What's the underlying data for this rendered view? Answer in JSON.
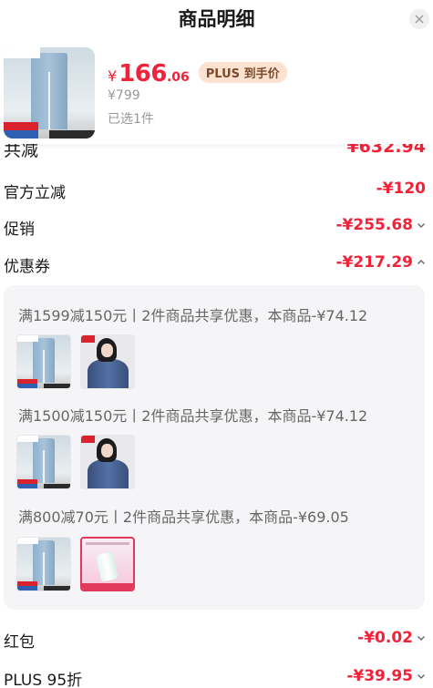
{
  "dialog": {
    "title": "商品明细"
  },
  "product": {
    "price_currency": "¥",
    "price_int": "166",
    "price_dec": ".06",
    "plus_badge": "PLUS 到手价",
    "original_price": "¥799",
    "selected_count": "已选1件"
  },
  "summary": {
    "total_label": "共减",
    "total_value": "¥632.94"
  },
  "rows": [
    {
      "label": "官方立减",
      "value": "-¥120",
      "chevron": "none"
    },
    {
      "label": "促销",
      "value": "-¥255.68",
      "chevron": "down"
    },
    {
      "label": "优惠券",
      "value": "-¥217.29",
      "chevron": "up"
    }
  ],
  "coupon_groups": [
    {
      "text": "满1599减150元丨2件商品共享优惠，本商品-¥74.12",
      "items": [
        "jeans",
        "jacket"
      ]
    },
    {
      "text": "满1500减150元丨2件商品共享优惠，本商品-¥74.12",
      "items": [
        "jeans",
        "jacket"
      ]
    },
    {
      "text": "满800减70元丨2件商品共享优惠，本商品-¥69.05",
      "items": [
        "jeans",
        "cosmetic"
      ]
    }
  ],
  "bottom_rows": [
    {
      "label": "红包",
      "value": "-¥0.02",
      "chevron": "down"
    },
    {
      "label": "PLUS 95折",
      "value": "-¥39.95",
      "chevron": "down"
    }
  ],
  "colors": {
    "accent_red": "#f0233a",
    "plus_badge_bg": "#fde2d2",
    "panel_bg": "#f5f5f7"
  }
}
